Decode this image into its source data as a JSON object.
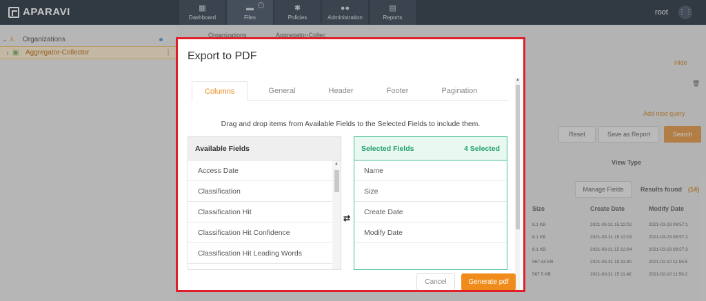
{
  "app": {
    "brand": "APARAVI",
    "user": "root"
  },
  "nav": {
    "tabs": [
      {
        "label": "Dashboard",
        "icon": "dashboard-icon"
      },
      {
        "label": "Files",
        "icon": "folder-icon"
      },
      {
        "label": "Policies",
        "icon": "gear-icon"
      },
      {
        "label": "Administration",
        "icon": "users-icon"
      },
      {
        "label": "Reports",
        "icon": "clipboard-icon"
      }
    ]
  },
  "tree": {
    "items": [
      {
        "label": "Organizations"
      },
      {
        "label": "Aggregator-Collector"
      }
    ]
  },
  "background": {
    "breadcrumb_root": "Organizations",
    "breadcrumb_item": "Aggregator-Collec",
    "hide_label": "Hide",
    "add_query": "Add next query",
    "reset": "Reset",
    "save_report": "Save as Report",
    "search": "Search",
    "view_type": "View Type",
    "manage_fields": "Manage Fields",
    "results_found": "Results found",
    "results_count": "(14)",
    "columns": [
      "Size",
      "Create Date",
      "Modify Date"
    ],
    "rows": [
      [
        "8.1 KB",
        "2021-03-31 15:12:02",
        "2021-03-23 09:57:1"
      ],
      [
        "8.1 KB",
        "2021-03-31 15:12:03",
        "2021-03-23 09:57:2"
      ],
      [
        "8.1 KB",
        "2021-03-31 15:12:04",
        "2021-03-23 09:57:3"
      ],
      [
        "567.44 KB",
        "2021-03-31 15:11:40",
        "2021-02-10 11:55:5"
      ],
      [
        "567.5 KB",
        "2021-03-31 15:11:42",
        "2021-02-10 11:56:2"
      ]
    ]
  },
  "modal": {
    "title": "Export to PDF",
    "tabs": [
      "Columns",
      "General",
      "Header",
      "Footer",
      "Pagination"
    ],
    "instruction": "Drag and drop items from Available Fields to the Selected Fields to include them.",
    "available": {
      "title": "Available Fields",
      "fields": [
        "Access Date",
        "Classification",
        "Classification Hit",
        "Classification Hit Confidence",
        "Classification Hit Leading Words"
      ]
    },
    "selected": {
      "title": "Selected Fields",
      "count_label": "4 Selected",
      "fields": [
        "Name",
        "Size",
        "Create Date",
        "Modify Date"
      ]
    },
    "cancel": "Cancel",
    "generate": "Generate pdf"
  },
  "colors": {
    "accent": "#f08c1b",
    "selected_green": "#22a06b",
    "highlight_border": "#e01f2a",
    "topbar": "#1d2a38"
  }
}
